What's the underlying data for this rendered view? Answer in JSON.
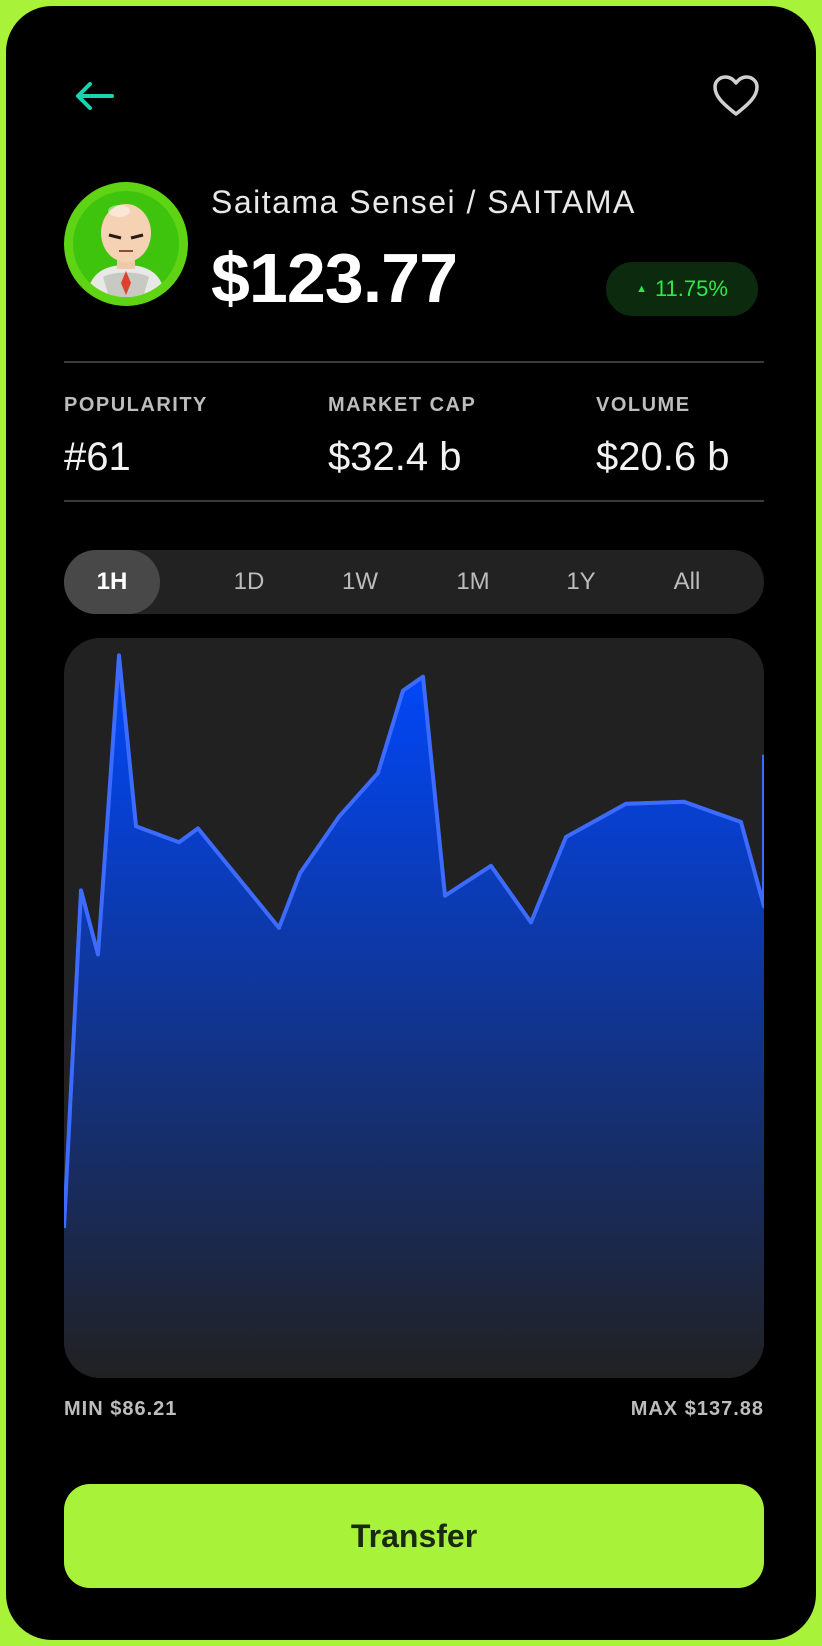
{
  "header": {
    "back_icon": "arrow-left-icon",
    "favorite_icon": "heart-outline-icon"
  },
  "token": {
    "name": "Saitama Sensei / SAITAMA",
    "price": "$123.77",
    "change": "11.75%",
    "change_direction": "up"
  },
  "stats": [
    {
      "label": "POPULARITY",
      "value": "#61"
    },
    {
      "label": "MARKET CAP",
      "value": "$32.4 b"
    },
    {
      "label": "VOLUME",
      "value": "$20.6 b"
    }
  ],
  "tabs": [
    {
      "label": "1H",
      "active": true
    },
    {
      "label": "1D",
      "active": false
    },
    {
      "label": "1W",
      "active": false
    },
    {
      "label": "1M",
      "active": false
    },
    {
      "label": "1Y",
      "active": false
    },
    {
      "label": "All",
      "active": false
    }
  ],
  "chart_data": {
    "type": "area",
    "y": [
      86.4,
      118.0,
      112.0,
      140.0,
      124.0,
      122.5,
      123.8,
      114.5,
      119.6,
      124.9,
      129.0,
      136.7,
      138.0,
      117.5,
      120.3,
      115.0,
      123.0,
      126.1,
      126.3,
      124.4,
      116.5,
      130.7
    ],
    "ylim": [
      86.21,
      137.88
    ],
    "colors": {
      "line": "#3d6bff",
      "fill_top": "#0048ff",
      "fill_bottom": "#212121"
    }
  },
  "range": {
    "min": "MIN $86.21",
    "max": "MAX $137.88"
  },
  "action": {
    "transfer": "Transfer"
  },
  "colors": {
    "accent": "#a8f23a",
    "positive": "#2ee84a",
    "back_arrow": "#19d4b0"
  }
}
